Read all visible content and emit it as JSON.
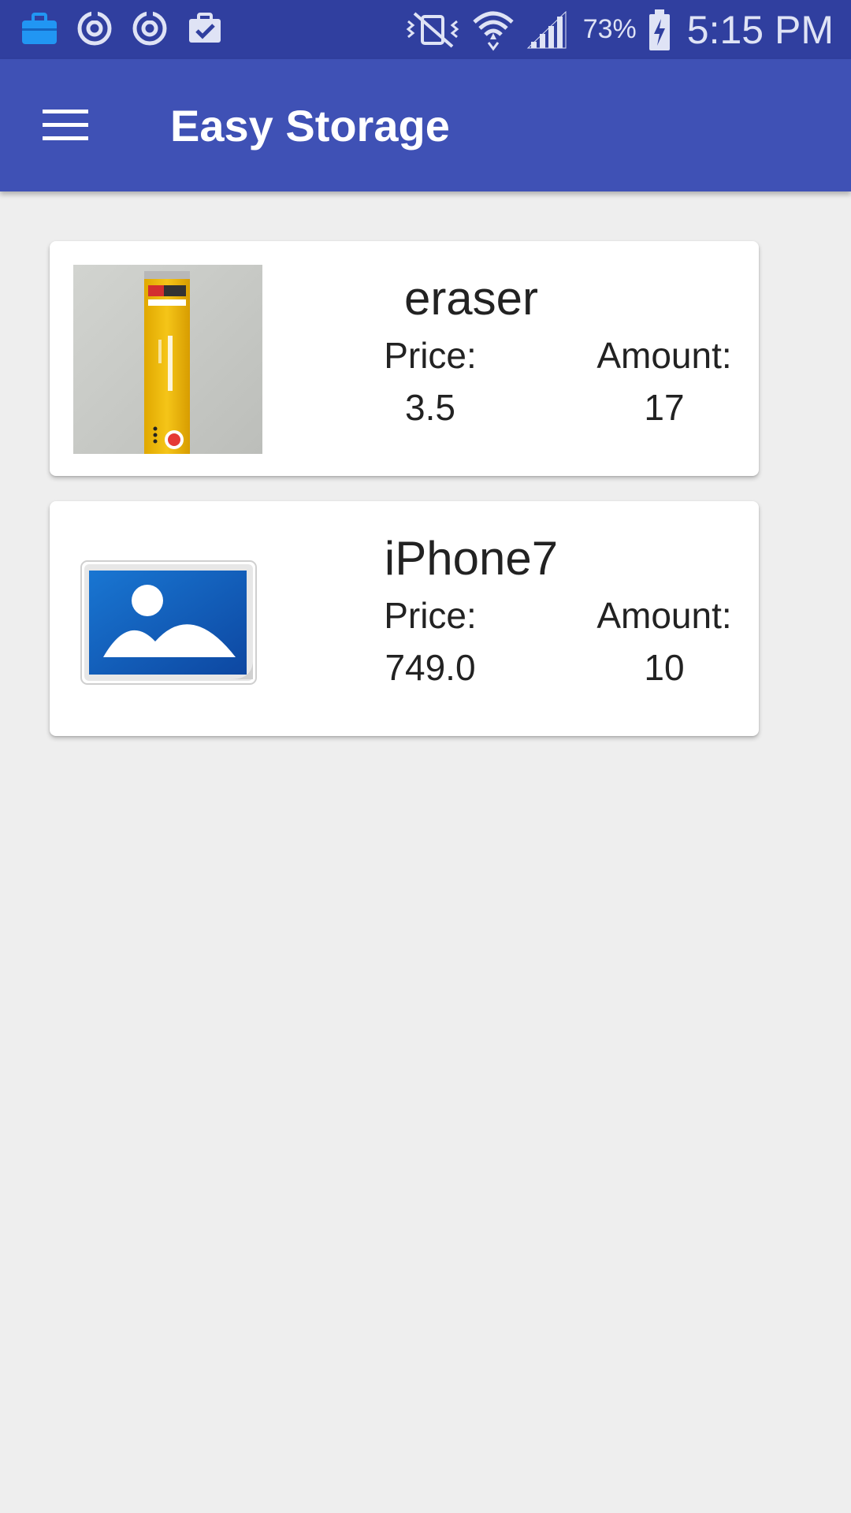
{
  "status_bar": {
    "battery_percent": "73%",
    "time": "5:15 PM",
    "left_icons": [
      "briefcase-icon",
      "sync-icon",
      "sync-icon",
      "clipboard-check-icon"
    ],
    "right_icons": [
      "vibrate-icon",
      "wifi-icon",
      "cell-signal-icon",
      "battery-charging-icon"
    ]
  },
  "app_bar": {
    "title": "Easy Storage",
    "menu_icon": "menu-icon",
    "color": "#3f51b5"
  },
  "items": [
    {
      "name": "eraser",
      "price_label": "Price:",
      "price": "3.5",
      "amount_label": "Amount:",
      "amount": "17",
      "image": "eraser-photo"
    },
    {
      "name": "iPhone7",
      "price_label": "Price:",
      "price": "749.0",
      "amount_label": "Amount:",
      "amount": "10",
      "image": "image-placeholder-icon"
    }
  ]
}
